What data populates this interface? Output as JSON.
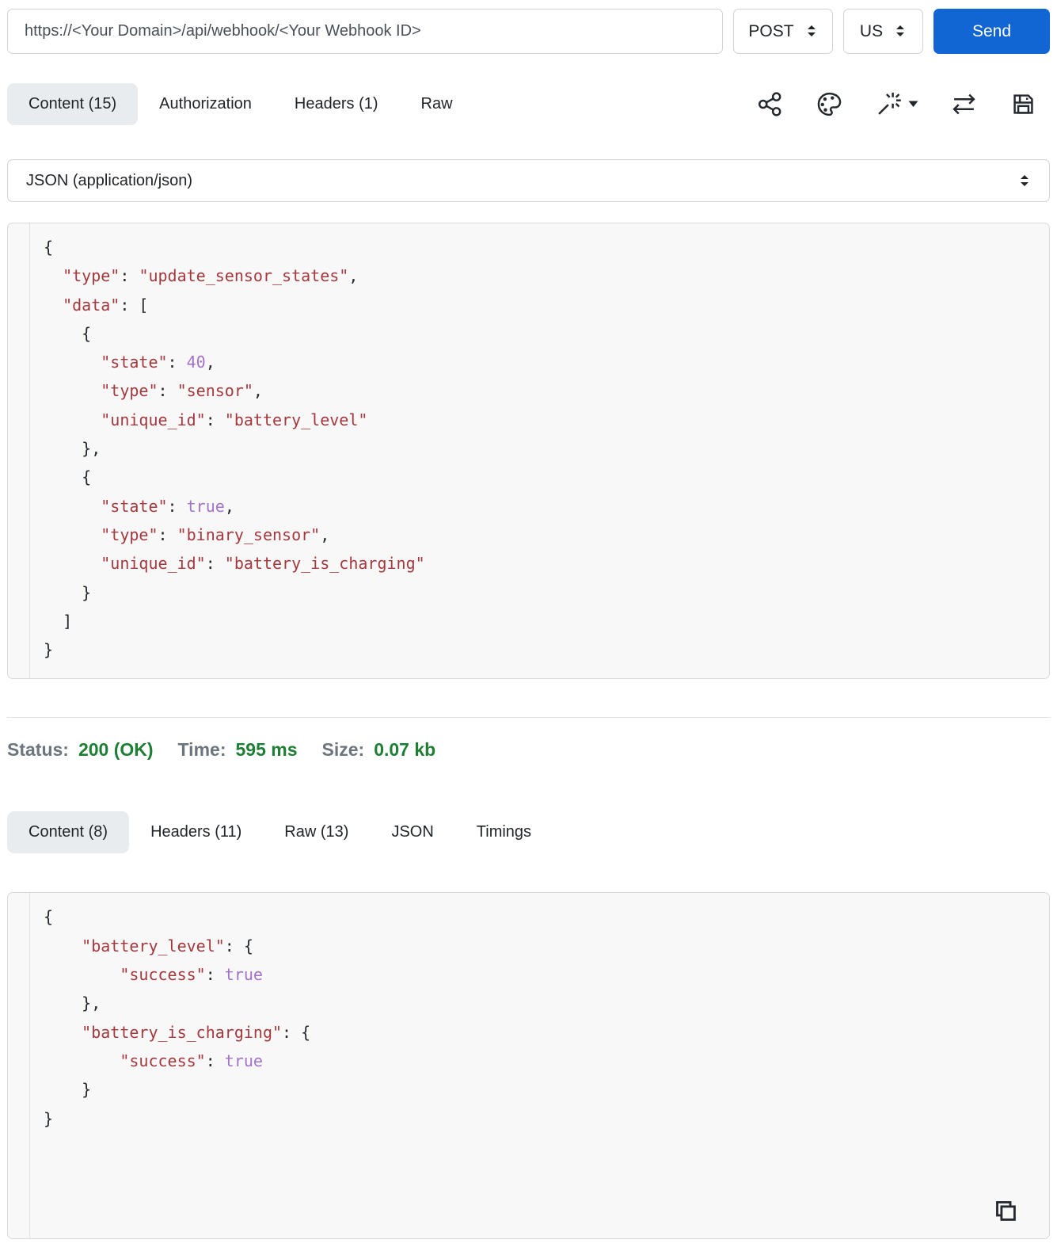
{
  "request_bar": {
    "url": "https://<Your Domain>/api/webhook/<Your Webhook ID>",
    "method": "POST",
    "locale": "US",
    "send_label": "Send"
  },
  "request_tabs": [
    {
      "label": "Content (15)",
      "active": true
    },
    {
      "label": "Authorization",
      "active": false
    },
    {
      "label": "Headers (1)",
      "active": false
    },
    {
      "label": "Raw",
      "active": false
    }
  ],
  "toolbar_icons": [
    "share-icon",
    "palette-icon",
    "magic-wand-icon",
    "swap-arrows-icon",
    "save-icon"
  ],
  "body_type": {
    "selected": "JSON (application/json)"
  },
  "request_body": {
    "lines": [
      [
        [
          "p",
          "{"
        ]
      ],
      [
        [
          "w",
          "  "
        ],
        [
          "s",
          "\"type\""
        ],
        [
          "p",
          ": "
        ],
        [
          "s",
          "\"update_sensor_states\""
        ],
        [
          "p",
          ","
        ]
      ],
      [
        [
          "w",
          "  "
        ],
        [
          "s",
          "\"data\""
        ],
        [
          "p",
          ": ["
        ]
      ],
      [
        [
          "w",
          "    "
        ],
        [
          "p",
          "{"
        ]
      ],
      [
        [
          "w",
          "      "
        ],
        [
          "s",
          "\"state\""
        ],
        [
          "p",
          ": "
        ],
        [
          "a",
          "40"
        ],
        [
          "p",
          ","
        ]
      ],
      [
        [
          "w",
          "      "
        ],
        [
          "s",
          "\"type\""
        ],
        [
          "p",
          ": "
        ],
        [
          "s",
          "\"sensor\""
        ],
        [
          "p",
          ","
        ]
      ],
      [
        [
          "w",
          "      "
        ],
        [
          "s",
          "\"unique_id\""
        ],
        [
          "p",
          ": "
        ],
        [
          "s",
          "\"battery_level\""
        ]
      ],
      [
        [
          "w",
          "    "
        ],
        [
          "p",
          "},"
        ]
      ],
      [
        [
          "w",
          "    "
        ],
        [
          "p",
          "{"
        ]
      ],
      [
        [
          "w",
          "      "
        ],
        [
          "s",
          "\"state\""
        ],
        [
          "p",
          ": "
        ],
        [
          "a",
          "true"
        ],
        [
          "p",
          ","
        ]
      ],
      [
        [
          "w",
          "      "
        ],
        [
          "s",
          "\"type\""
        ],
        [
          "p",
          ": "
        ],
        [
          "s",
          "\"binary_sensor\""
        ],
        [
          "p",
          ","
        ]
      ],
      [
        [
          "w",
          "      "
        ],
        [
          "s",
          "\"unique_id\""
        ],
        [
          "p",
          ": "
        ],
        [
          "s",
          "\"battery_is_charging\""
        ]
      ],
      [
        [
          "w",
          "    "
        ],
        [
          "p",
          "}"
        ]
      ],
      [
        [
          "w",
          "  "
        ],
        [
          "p",
          "]"
        ]
      ],
      [
        [
          "p",
          "}"
        ]
      ]
    ]
  },
  "response_status": {
    "status_label": "Status:",
    "status_value": "200 (OK)",
    "time_label": "Time:",
    "time_value": "595 ms",
    "size_label": "Size:",
    "size_value": "0.07 kb"
  },
  "response_tabs": [
    {
      "label": "Content (8)",
      "active": true
    },
    {
      "label": "Headers (11)",
      "active": false
    },
    {
      "label": "Raw (13)",
      "active": false
    },
    {
      "label": "JSON",
      "active": false
    },
    {
      "label": "Timings",
      "active": false
    }
  ],
  "response_body": {
    "lines": [
      [
        [
          "p",
          "{"
        ]
      ],
      [
        [
          "w",
          "    "
        ],
        [
          "s",
          "\"battery_level\""
        ],
        [
          "p",
          ": {"
        ]
      ],
      [
        [
          "w",
          "        "
        ],
        [
          "s",
          "\"success\""
        ],
        [
          "p",
          ": "
        ],
        [
          "a",
          "true"
        ]
      ],
      [
        [
          "w",
          "    "
        ],
        [
          "p",
          "},"
        ]
      ],
      [
        [
          "w",
          "    "
        ],
        [
          "s",
          "\"battery_is_charging\""
        ],
        [
          "p",
          ": {"
        ]
      ],
      [
        [
          "w",
          "        "
        ],
        [
          "s",
          "\"success\""
        ],
        [
          "p",
          ": "
        ],
        [
          "a",
          "true"
        ]
      ],
      [
        [
          "w",
          "    "
        ],
        [
          "p",
          "}"
        ]
      ],
      [
        [
          "p",
          "}"
        ]
      ]
    ]
  },
  "colors": {
    "accent_blue": "#1266d3",
    "success_green": "#1e7e34",
    "code_string_red": "#a5383d",
    "code_atom_purple": "#a273c8",
    "active_tab_bg": "#e9ecef"
  }
}
